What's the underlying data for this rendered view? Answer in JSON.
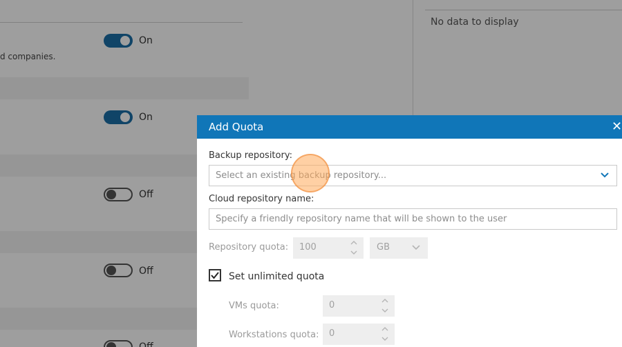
{
  "background": {
    "description_tail": "d companies.",
    "no_data_text": "No data to display",
    "toggles": [
      {
        "state": "on",
        "label": "On"
      },
      {
        "state": "on",
        "label": "On"
      },
      {
        "state": "off",
        "label": "Off"
      },
      {
        "state": "off",
        "label": "Off"
      },
      {
        "state": "off",
        "label": "Off"
      }
    ]
  },
  "dialog": {
    "title": "Add Quota",
    "close_icon": "close-icon",
    "backup_repository": {
      "label": "Backup repository:",
      "placeholder": "Select an existing backup repository..."
    },
    "cloud_repository_name": {
      "label": "Cloud repository name:",
      "placeholder": "Specify a friendly repository name that will be shown to the user"
    },
    "repository_quota": {
      "label": "Repository quota:",
      "value": "100",
      "unit": "GB"
    },
    "unlimited_quota": {
      "label": "Set unlimited quota",
      "checked": true
    },
    "vms_quota": {
      "label": "VMs quota:",
      "value": "0"
    },
    "workstations_quota": {
      "label": "Workstations quota:",
      "value": "0"
    }
  },
  "colors": {
    "header": "#1076b8",
    "toggle_on": "#1b6ea6"
  }
}
